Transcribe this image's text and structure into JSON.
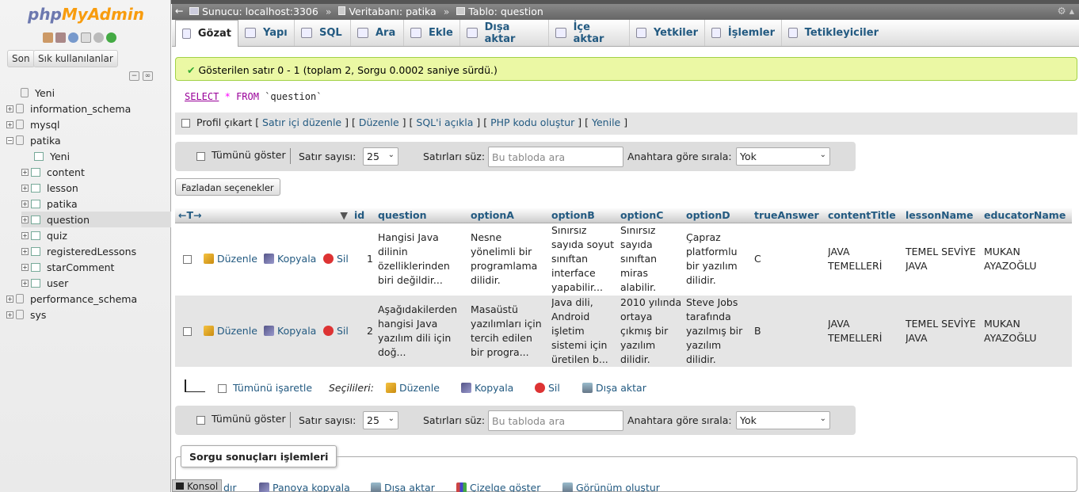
{
  "logo": {
    "part1": "php",
    "part2": "MyAdmin"
  },
  "sidebar": {
    "recent_label": "Son",
    "favorites_label": "Sık kullanılanlar",
    "new_label": "Yeni",
    "databases": [
      "information_schema",
      "mysql",
      "patika",
      "performance_schema",
      "sys"
    ],
    "patika_new": "Yeni",
    "patika_tables": [
      "content",
      "lesson",
      "patika",
      "question",
      "quiz",
      "registeredLessons",
      "starComment",
      "user"
    ]
  },
  "breadcrumb": {
    "server": "Sunucu: localhost:3306",
    "database": "Veritabanı: patika",
    "table": "Tablo: question"
  },
  "tabs": [
    "Gözat",
    "Yapı",
    "SQL",
    "Ara",
    "Ekle",
    "Dışa aktar",
    "İçe aktar",
    "Yetkiler",
    "İşlemler",
    "Tetikleyiciler"
  ],
  "success_message": "Gösterilen satır 0 - 1 (toplam 2, Sorgu 0.0002 saniye sürdü.)",
  "sql": {
    "select": "SELECT",
    "star": "*",
    "from": "FROM",
    "table": "`question`"
  },
  "profiling": {
    "label": "Profil çıkart",
    "links": [
      "Satır içi düzenle",
      "Düzenle",
      "SQL'i açıkla",
      "PHP kodu oluştur",
      "Yenile"
    ]
  },
  "navbar": {
    "show_all": "Tümünü göster",
    "rows_label": "Satır sayısı:",
    "rows_value": "25",
    "filter_label": "Satırları süz:",
    "filter_placeholder": "Bu tabloda ara",
    "sort_label": "Anahtara göre sırala:",
    "sort_value": "Yok"
  },
  "more_options": "Fazladan seçenekler",
  "columns": [
    "id",
    "question",
    "optionA",
    "optionB",
    "optionC",
    "optionD",
    "trueAnswer",
    "contentTitle",
    "lessonName",
    "educatorName"
  ],
  "row_actions": {
    "edit": "Düzenle",
    "copy": "Kopyala",
    "delete": "Sil"
  },
  "rows": [
    {
      "id": "1",
      "question": "Hangisi Java dilinin özelliklerinden biri değildir...",
      "optionA": "Nesne yönelimli bir programlama dilidir.",
      "optionB": "Sınırsız sayıda soyut sınıftan interface yapabilir...",
      "optionC": "Sınırsız sayıda sınıftan miras alabilir.",
      "optionD": "Çapraz platformlu bir yazılım dilidir.",
      "trueAnswer": "C",
      "contentTitle": "JAVA TEMELLERİ",
      "lessonName": "TEMEL SEVİYE JAVA",
      "educatorName": "MUKAN AYAZOĞLU"
    },
    {
      "id": "2",
      "question": "Aşağıdakilerden hangisi Java yazılım dili için doğ...",
      "optionA": "Masaüstü yazılımları için tercih edilen bir progra...",
      "optionB": "Java dili, Android işletim sistemi için üretilen b...",
      "optionC": "2010 yılında ortaya çıkmış bir yazılım dilidir.",
      "optionD": "Steve Jobs tarafında yazılmış bir yazılım dilidir.",
      "trueAnswer": "B",
      "contentTitle": "JAVA TEMELLERİ",
      "lessonName": "TEMEL SEVİYE JAVA",
      "educatorName": "MUKAN AYAZOĞLU"
    }
  ],
  "bulk": {
    "check_all": "Tümünü işaretle",
    "with_selected": "Seçilileri:",
    "edit": "Düzenle",
    "copy": "Kopyala",
    "delete": "Sil",
    "export": "Dışa aktar"
  },
  "query_ops": {
    "title": "Sorgu sonuçları işlemleri",
    "items": [
      "dır",
      "Panoya kopyala",
      "Dışa aktar",
      "Çizelge göster",
      "Görünüm oluştur"
    ]
  },
  "console": "Konsol"
}
